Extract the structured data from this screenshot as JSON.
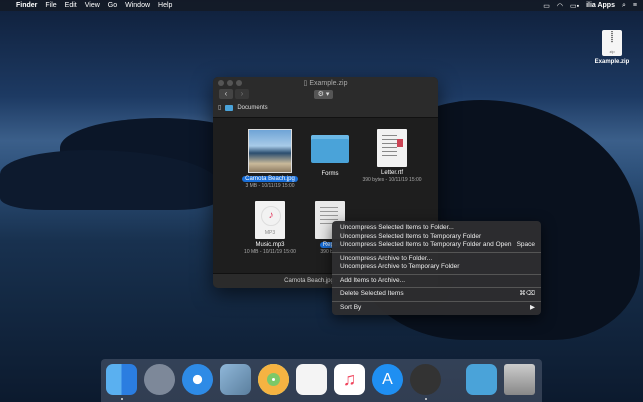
{
  "menubar": {
    "apple": "",
    "app_name": "Finder",
    "menus": [
      "File",
      "Edit",
      "View",
      "Go",
      "Window",
      "Help"
    ],
    "user": "ilia Apps"
  },
  "desktop": {
    "file_label": "Example.zip",
    "file_ext": "zip"
  },
  "window": {
    "title": "Example.zip",
    "back": "‹",
    "forward": "›",
    "gear": "⚙ ▾",
    "path_label": "Documents",
    "items": [
      {
        "name": "Carnota Beach.jpg",
        "meta": "3 MB - 10/11/19 15:00",
        "selected": true
      },
      {
        "name": "Forms",
        "meta": "",
        "selected": false
      },
      {
        "name": "Letter.rtf",
        "meta": "390 bytes - 10/11/19 15:00",
        "selected": false
      },
      {
        "name": "Music.mp3",
        "meta": "10 MB - 10/11/19 15:00",
        "selected": false,
        "badge": "MP3"
      },
      {
        "name": "Repo",
        "meta": "390 byte",
        "selected": true
      }
    ],
    "status": "Carnota Beach.jpg - 3 MB (3 M"
  },
  "context_menu": {
    "items": [
      {
        "label": "Uncompress Selected Items to Folder...",
        "shortcut": ""
      },
      {
        "label": "Uncompress Selected Items to Temporary Folder",
        "shortcut": ""
      },
      {
        "label": "Uncompress Selected Items to Temporary Folder and Open",
        "shortcut": "Space"
      },
      {
        "label": "Uncompress Archive to Folder...",
        "shortcut": ""
      },
      {
        "label": "Uncompress Archive to Temporary Folder",
        "shortcut": ""
      },
      {
        "label": "Add Items to Archive...",
        "shortcut": ""
      },
      {
        "label": "Delete Selected Items",
        "shortcut": "⌘⌫"
      },
      {
        "label": "Sort By",
        "shortcut": "▶"
      }
    ]
  },
  "dock": {
    "apps": [
      "finder-icon",
      "launchpad-icon",
      "safari-icon",
      "mail-icon",
      "photos-icon",
      "reminders-icon",
      "music-icon",
      "app-store-icon",
      "archiver-icon",
      "downloads-icon",
      "trash-icon"
    ]
  },
  "colors": {
    "selection": "#1a6fd8",
    "folder": "#4aa3d9"
  }
}
